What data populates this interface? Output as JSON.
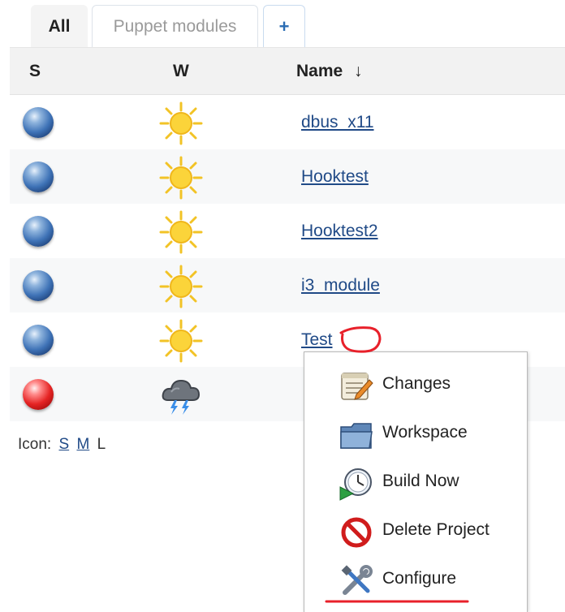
{
  "tabs": [
    {
      "label": "All",
      "active": true
    },
    {
      "label": "Puppet modules",
      "active": false
    },
    {
      "label": "+",
      "active": false
    }
  ],
  "table": {
    "headers": {
      "status": "S",
      "weather": "W",
      "name": "Name",
      "sort_indicator": "↓"
    },
    "rows": [
      {
        "status_icon": "blue-ball-icon",
        "weather_icon": "sunny-icon",
        "name": "dbus_x11"
      },
      {
        "status_icon": "blue-ball-icon",
        "weather_icon": "sunny-icon",
        "name": "Hooktest"
      },
      {
        "status_icon": "blue-ball-icon",
        "weather_icon": "sunny-icon",
        "name": "Hooktest2"
      },
      {
        "status_icon": "blue-ball-icon",
        "weather_icon": "sunny-icon",
        "name": "i3_module"
      },
      {
        "status_icon": "blue-ball-icon",
        "weather_icon": "sunny-icon",
        "name": "Test"
      },
      {
        "status_icon": "red-ball-icon",
        "weather_icon": "thunderstorm-icon",
        "name": ""
      }
    ]
  },
  "icon_size": {
    "label": "Icon:",
    "options": [
      "S",
      "M",
      "L"
    ],
    "current": "L"
  },
  "context_menu": {
    "items": [
      {
        "label": "Changes",
        "icon": "notepad-icon"
      },
      {
        "label": "Workspace",
        "icon": "folder-icon"
      },
      {
        "label": "Build Now",
        "icon": "clock-play-icon"
      },
      {
        "label": "Delete Project",
        "icon": "no-entry-icon"
      },
      {
        "label": "Configure",
        "icon": "tools-icon"
      }
    ]
  },
  "colors": {
    "link": "#204a87",
    "header_bg": "#f2f2f2",
    "alt_row_bg": "#f7f8f9",
    "annotation_red": "#e8202a",
    "status_blue": "#3f73b7",
    "status_red": "#e52424"
  }
}
